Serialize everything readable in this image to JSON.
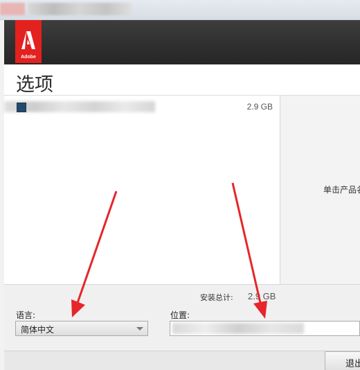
{
  "logo": {
    "text": "Adobe"
  },
  "page": {
    "title": "选项"
  },
  "product_list": {
    "items": [
      {
        "name": "",
        "size": "2.9 GB"
      }
    ]
  },
  "right_panel": {
    "hint": "单击产品名"
  },
  "summary": {
    "total_label": "安装总计:",
    "total_value": "2.9 GB"
  },
  "language": {
    "label": "语言:",
    "selected": "简体中文"
  },
  "location": {
    "label": "位置:",
    "value": ""
  },
  "footer": {
    "exit_label": "退出"
  },
  "colors": {
    "adobe_red": "#e3211e",
    "header_dark": "#333333",
    "annotation_arrow": "#e5262b"
  },
  "icons": [
    "adobe-logo-icon",
    "dropdown-arrow-icon",
    "annotation-arrow-icon"
  ]
}
